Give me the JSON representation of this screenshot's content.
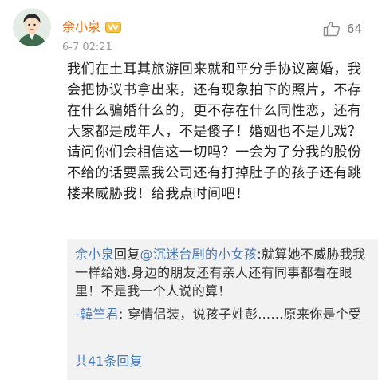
{
  "post": {
    "author": "余小泉",
    "time": "6-7 02:21",
    "like_count": "64",
    "body": "我们在土耳其旅游回来就和平分手协议离婚，我会把协议书拿出来，还有现象拍下的照片，不存在什么骗婚什么的，更不存在什么同性恋，还有大家都是成年人，不是傻子！婚姻也不是儿戏？请问你们会相信这一切吗？一会为了分我的股份不给的话要黑我公司还有打掉肚子的孩子还有跳楼来威胁我！给我点时间吧！"
  },
  "replies": {
    "reply_1": {
      "author": "余小泉",
      "action": "回复",
      "mention": "@沉迷台剧的小女孩",
      "colon": ":",
      "text": "就算她不威胁我我一样给她.身边的朋友还有亲人还有同事都看在眼里！不是我一个人说的算！"
    },
    "reply_2": {
      "author": "-韓竺君",
      "colon": ":",
      "text": " 穿情侣装，说孩子姓彭……原来你是个受"
    },
    "more_label": "共41条回复",
    "more_arrow": "›"
  },
  "icons": {
    "avatar": "avatar-icon",
    "badge": "member-badge-icon",
    "like": "thumbs-up-icon"
  },
  "colors": {
    "username": "#e86e1a",
    "link": "#4979b6",
    "reply_background": "#f2f2f2",
    "timestamp": "#9a9a9a"
  }
}
